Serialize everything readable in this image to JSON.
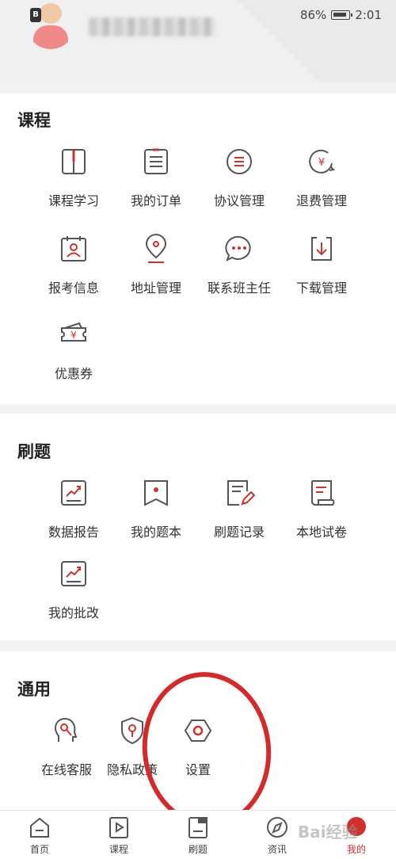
{
  "status_bar": {
    "battery": "86%",
    "time": "2:01"
  },
  "profile": {
    "avatar_icon": "user-avatar-icon",
    "lock_badge": "B"
  },
  "sections": {
    "course": {
      "title": "课程",
      "items": [
        {
          "label": "课程学习",
          "icon": "book-icon"
        },
        {
          "label": "我的订单",
          "icon": "order-list-icon"
        },
        {
          "label": "协议管理",
          "icon": "agreement-icon"
        },
        {
          "label": "退费管理",
          "icon": "refund-icon"
        },
        {
          "label": "报考信息",
          "icon": "exam-registration-icon"
        },
        {
          "label": "地址管理",
          "icon": "location-pin-icon"
        },
        {
          "label": "联系班主任",
          "icon": "chat-bubble-icon"
        },
        {
          "label": "下载管理",
          "icon": "download-icon"
        },
        {
          "label": "优惠券",
          "icon": "coupon-icon"
        }
      ]
    },
    "practice": {
      "title": "刷题",
      "items": [
        {
          "label": "数据报告",
          "icon": "chart-report-icon"
        },
        {
          "label": "我的题本",
          "icon": "bookmark-book-icon"
        },
        {
          "label": "刷题记录",
          "icon": "edit-record-icon"
        },
        {
          "label": "本地试卷",
          "icon": "paper-scroll-icon"
        },
        {
          "label": "我的批改",
          "icon": "correction-chart-icon"
        }
      ]
    },
    "general": {
      "title": "通用",
      "items": [
        {
          "label": "在线客服",
          "icon": "customer-service-icon"
        },
        {
          "label": "隐私政策",
          "icon": "shield-icon"
        },
        {
          "label": "设置",
          "icon": "gear-icon"
        }
      ]
    }
  },
  "tabbar": {
    "tabs": [
      {
        "label": "首页",
        "icon": "home-icon"
      },
      {
        "label": "课程",
        "icon": "play-course-icon"
      },
      {
        "label": "刷题",
        "icon": "question-bank-icon"
      },
      {
        "label": "资讯",
        "icon": "compass-icon"
      },
      {
        "label": "我的",
        "icon": "profile-icon"
      }
    ],
    "active_index": 4
  },
  "watermark": "Bai经验",
  "colors": {
    "accent": "#d0312d",
    "icon_stroke": "#555555"
  }
}
